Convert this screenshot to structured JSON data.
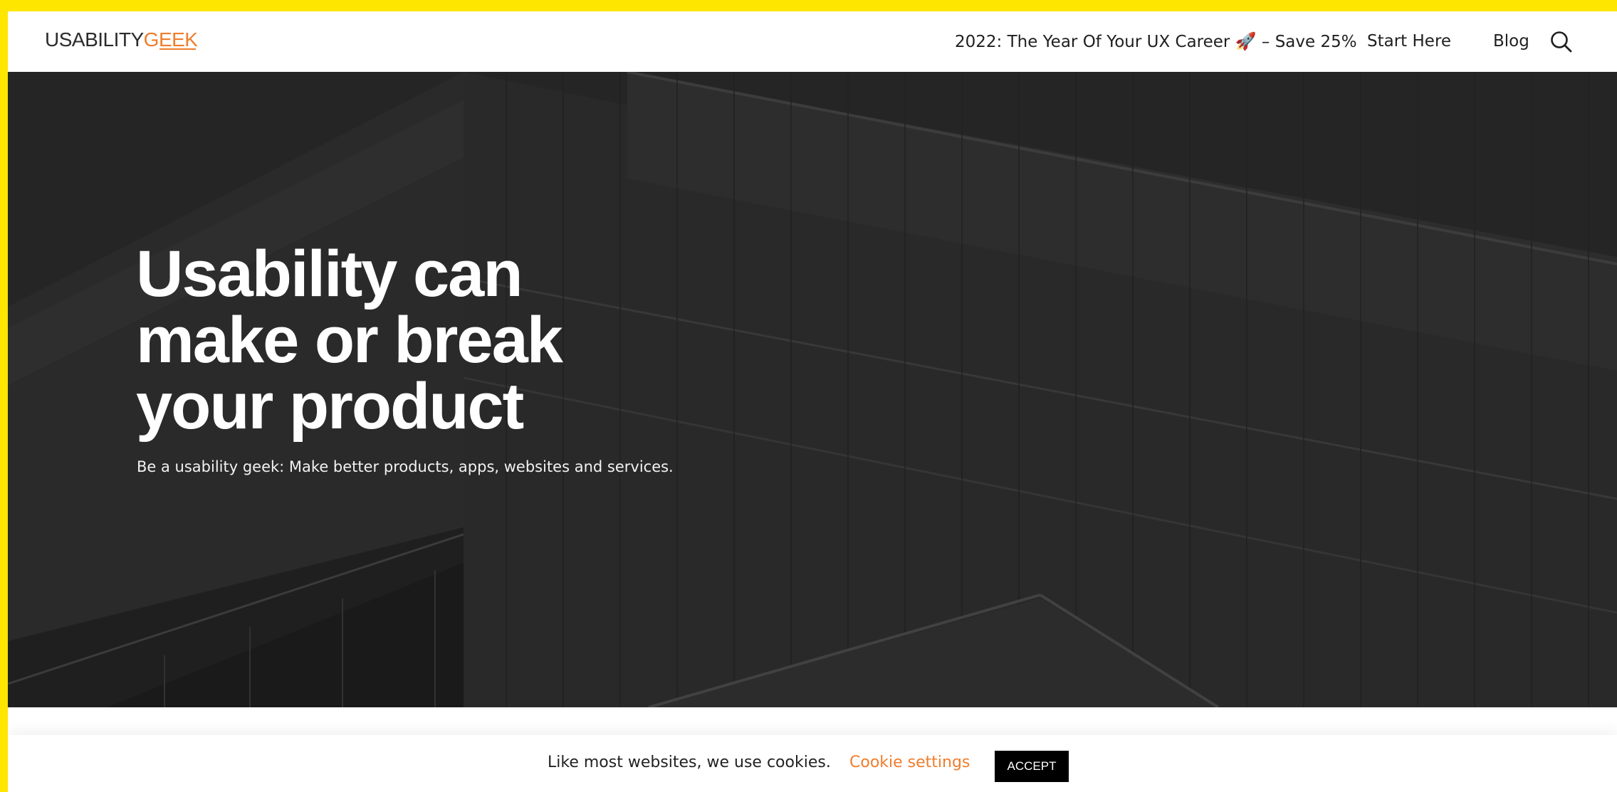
{
  "header": {
    "logo_dark": "USABILITY",
    "logo_accent": "GEEK",
    "promo_label": "2022: The Year Of Your UX Career",
    "promo_emoji": "🚀",
    "promo_suffix": "– Save 25%",
    "start_label": "Start Here",
    "blog_label": "Blog",
    "search_icon": "search-icon"
  },
  "hero": {
    "title_line1": "Usability can",
    "title_line2": "make or break",
    "title_line3": "your product",
    "subtitle": "Be a usability geek: Make better products, apps, websites and services."
  },
  "cookie": {
    "message": "Like most websites, we use cookies.",
    "settings_label": "Cookie settings",
    "accept_label": "ACCEPT"
  },
  "colors": {
    "frame": "#ffe600",
    "accent": "#ef7d2d",
    "hero_overlay": "#2a2a2a",
    "accept_bg": "#000000"
  }
}
